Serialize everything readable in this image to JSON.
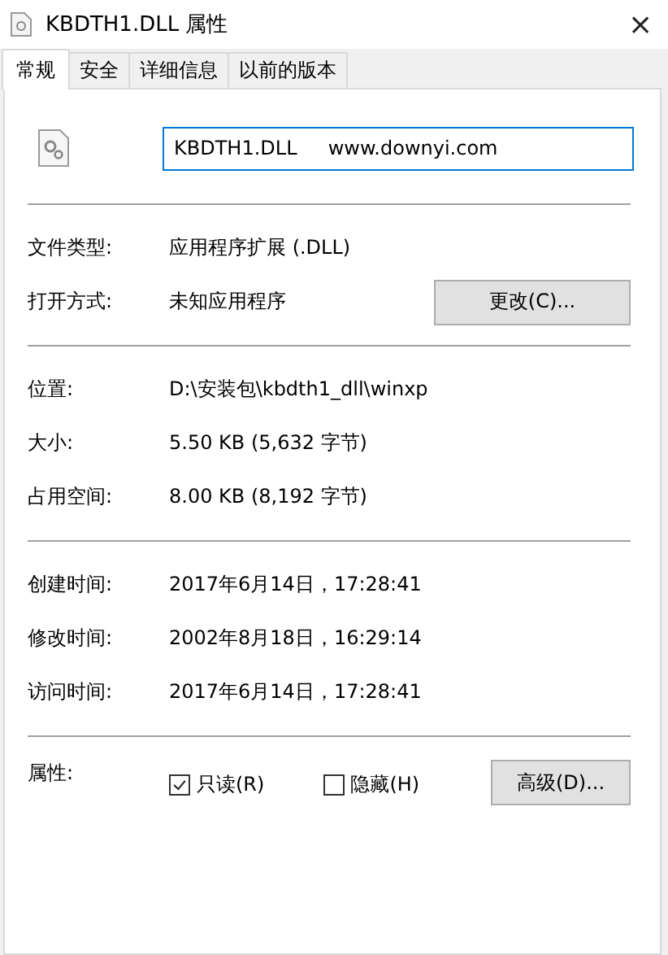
{
  "window": {
    "title": "KBDTH1.DLL 属性",
    "close": "×"
  },
  "tabs": [
    {
      "label": "常规",
      "selected": true
    },
    {
      "label": "安全",
      "selected": false
    },
    {
      "label": "详细信息",
      "selected": false
    },
    {
      "label": "以前的版本",
      "selected": false
    }
  ],
  "file": {
    "name_value": "KBDTH1.DLL     www.downyi.com"
  },
  "sections": [
    [
      {
        "label": "文件类型:",
        "value": "应用程序扩展 (.DLL)"
      },
      {
        "label": "打开方式:",
        "value": "未知应用程序",
        "button": "更改(C)..."
      }
    ],
    [
      {
        "label": "位置:",
        "value": "D:\\安装包\\kbdth1_dll\\winxp"
      },
      {
        "label": "大小:",
        "value": "5.50 KB (5,632 字节)"
      },
      {
        "label": "占用空间:",
        "value": "8.00 KB (8,192 字节)"
      }
    ],
    [
      {
        "label": "创建时间:",
        "value": "2017年6月14日，17:28:41"
      },
      {
        "label": "修改时间:",
        "value": "2002年8月18日，16:29:14"
      },
      {
        "label": "访问时间:",
        "value": "2017年6月14日，17:28:41"
      }
    ]
  ],
  "attributes": {
    "label": "属性:",
    "options": [
      {
        "label": "只读(R)",
        "checked": true
      },
      {
        "label": "隐藏(H)",
        "checked": false
      }
    ],
    "button": "高级(D)..."
  }
}
